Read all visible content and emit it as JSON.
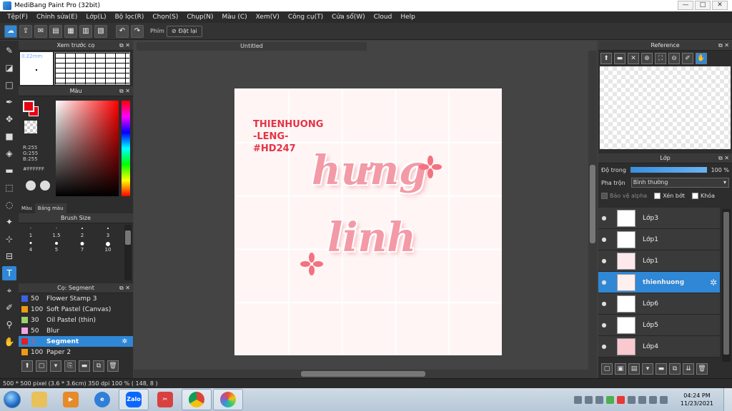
{
  "window": {
    "title": "MediBang Paint Pro (32bit)",
    "minimize": "—",
    "maximize": "□",
    "close": "✕"
  },
  "menu": [
    "Tệp(F)",
    "Chỉnh sửa(E)",
    "Lớp(L)",
    "Bộ lọc(R)",
    "Chọn(S)",
    "Chụp(N)",
    "Màu (C)",
    "Xem(V)",
    "Công cụ(T)",
    "Cửa sổ(W)",
    "Cloud",
    "Help"
  ],
  "toolbar": {
    "phim_label": "Phím",
    "reset_label": "Đặt lại"
  },
  "brush_preview": {
    "title": "Xem trước cọ",
    "size": "0.22mm"
  },
  "color": {
    "title": "Màu",
    "r": "R:255",
    "g": "G:255",
    "b": "B:255",
    "hex": "#FFFFFF",
    "tab_color": "Màu",
    "tab_palette": "Bảng màu",
    "fg": "#e60012"
  },
  "brush_size": {
    "title": "Brush Size",
    "sizes": [
      "1",
      "1.5",
      "2",
      "3",
      "4",
      "5",
      "7",
      "10"
    ]
  },
  "brush_panel": {
    "title": "Cọ: Segment",
    "items": [
      {
        "size": "50",
        "name": "Flower Stamp 3",
        "color": "#3b63e0"
      },
      {
        "size": "100",
        "name": "Soft Pastel (Canvas)",
        "color": "#ef9a14"
      },
      {
        "size": "30",
        "name": "Oil Pastel (thin)",
        "color": "#9bd36b"
      },
      {
        "size": "50",
        "name": "Blur",
        "color": "#f2a6e6"
      },
      {
        "size": "3",
        "name": "Segment",
        "color": "#e02020",
        "selected": true
      },
      {
        "size": "100",
        "name": "Paper 2",
        "color": "#ef9a14"
      }
    ]
  },
  "canvas": {
    "doc_title": "Untitled",
    "caption": [
      "THIENHUONG",
      "-LENG-",
      "#HD247"
    ],
    "script_top": "hưng",
    "script_bottom": "linh"
  },
  "reference": {
    "title": "Reference"
  },
  "layers_panel": {
    "title": "Lớp",
    "opacity_label": "Độ trong",
    "opacity_value": "100 %",
    "blend_label": "Pha trộn",
    "blend_value": "Bình thường",
    "protect_alpha": "Bảo vệ alpha",
    "clipping": "Xén bớt",
    "lock": "Khóa",
    "layers": [
      {
        "name": "Lớp3"
      },
      {
        "name": "Lớp1"
      },
      {
        "name": "Lớp1"
      },
      {
        "name": "thienhuong",
        "selected": true
      },
      {
        "name": "Lớp6"
      },
      {
        "name": "Lớp5"
      },
      {
        "name": "Lớp4"
      }
    ]
  },
  "status": {
    "text": "500 * 500 pixel   (3.6 * 3.6cm)   350 dpi   100 %   ( 148, 8 )"
  },
  "taskbar": {
    "time": "04:24 PM",
    "date": "11/23/2021",
    "zalo": "Zalo"
  }
}
